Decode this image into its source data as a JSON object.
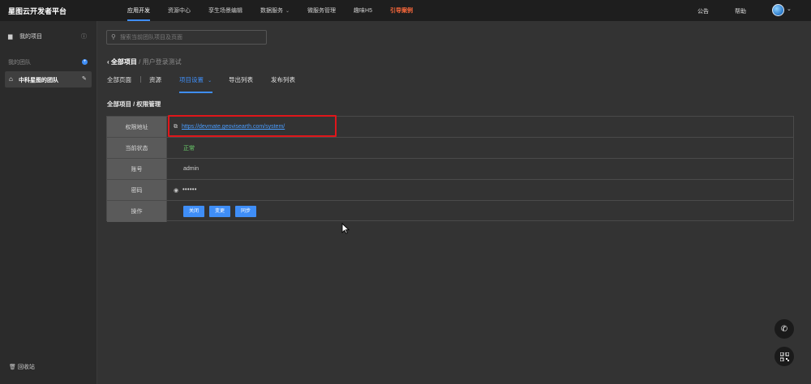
{
  "brand": "星图云开发者平台",
  "topnav": [
    {
      "label": "应用开发",
      "active": true
    },
    {
      "label": "资源中心"
    },
    {
      "label": "孪生场景编辑"
    },
    {
      "label": "数据服务",
      "caret": true
    },
    {
      "label": "微服务管理"
    },
    {
      "label": "趣味H5"
    },
    {
      "label": "引导案例",
      "highlight": true
    }
  ],
  "top_right": {
    "notice": "公告",
    "help": "帮助",
    "caret": "⌄"
  },
  "sidebar": {
    "my_project": "我的项目",
    "my_team": "我的团队",
    "team_active": "中科星图的团队",
    "recycle": "回收站"
  },
  "search": {
    "placeholder": "搜索当前团队项目及页面"
  },
  "breadcrumb": {
    "back": "全部项目",
    "sep": "/",
    "current": "用户登录测试"
  },
  "tabs": {
    "all_pages": "全部页面",
    "resources": "资源",
    "project_settings": "项目设置",
    "export_list": "导出列表",
    "publish_list": "发布列表",
    "caret": "⌄"
  },
  "section_title": "全部项目 / 权限管理",
  "table": {
    "rows": [
      {
        "label": "权限地址",
        "value": "https://devmate.geovisearth.com/system/"
      },
      {
        "label": "当前状态",
        "value": "正常"
      },
      {
        "label": "账号",
        "value": "admin"
      },
      {
        "label": "密码",
        "value": "••••••"
      },
      {
        "label": "操作"
      }
    ],
    "buttons": {
      "close": "关闭",
      "change": "变更",
      "sync": "同步"
    }
  },
  "colors": {
    "accent": "#3f8ef7",
    "highlight": "#ff6a3c",
    "ok": "#6cd36c",
    "box": "#e0161a"
  }
}
